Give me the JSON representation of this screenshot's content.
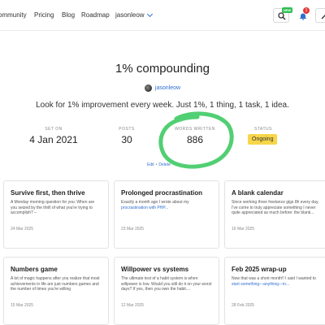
{
  "nav": {
    "links": [
      "ommunity",
      "Pricing",
      "Blog",
      "Roadmap"
    ],
    "user": "jasonleow",
    "new_badge": "NEW",
    "notification_count": "1",
    "icons": [
      "search-icon",
      "bell-icon",
      "pen-icon"
    ]
  },
  "streak": {
    "title": "1% compounding",
    "author": "jasonleow",
    "tagline": "Look for 1% improvement every week. Just 1%, 1 thing, 1 task, 1 idea.",
    "stats": [
      {
        "label": "SET ON",
        "value": "4 Jan 2021"
      },
      {
        "label": "POSTS",
        "value": "30"
      },
      {
        "label": "WORDS WRITTEN",
        "value": "886"
      },
      {
        "label": "STATUS",
        "value": "Ongoing"
      }
    ],
    "edit_label": "Edit",
    "delete_label": "Delete",
    "annotation_color": "#33c75a",
    "status_color": "#f7d64a",
    "accent_color": "#2f6fd0"
  },
  "posts": [
    {
      "title": "Survive first, then thrive",
      "excerpt": "A Monday morning question for you: When are you seized by the thrill of what you're trying to accomplish? –",
      "link_text": "",
      "date": "24 Mar 2025"
    },
    {
      "title": "Prolonged procrastination",
      "excerpt": "Exactly a month ago I wrote about my ",
      "link_text": "procrastination with PHP...",
      "date": "23 Mar 2025"
    },
    {
      "title": "A blank calendar",
      "excerpt": "Since working three freelance gigs 8h every day, I've come to truly appreciate something I never quite appreciated as much before: the blank...",
      "link_text": "",
      "date": "16 Mar 2025"
    },
    {
      "title": "Numbers game",
      "excerpt": "A lot of magic happens after you realize that most achievements in life are just numbers games and the number of times you're willing",
      "link_text": "",
      "date": "15 Mar 2025"
    },
    {
      "title": "Willpower vs systems",
      "excerpt": "The ultimate test of a habit system is when willpower is low. Would you still do it on your worst days? If yes, then you own the habit....",
      "link_text": "",
      "date": "12 Mar 2025"
    },
    {
      "title": "Feb 2025 wrap-up",
      "excerpt": "Now that was a short month!! I said I wanted to ",
      "link_text": "start something—anything—in...",
      "date": "28 Feb 2025"
    }
  ]
}
